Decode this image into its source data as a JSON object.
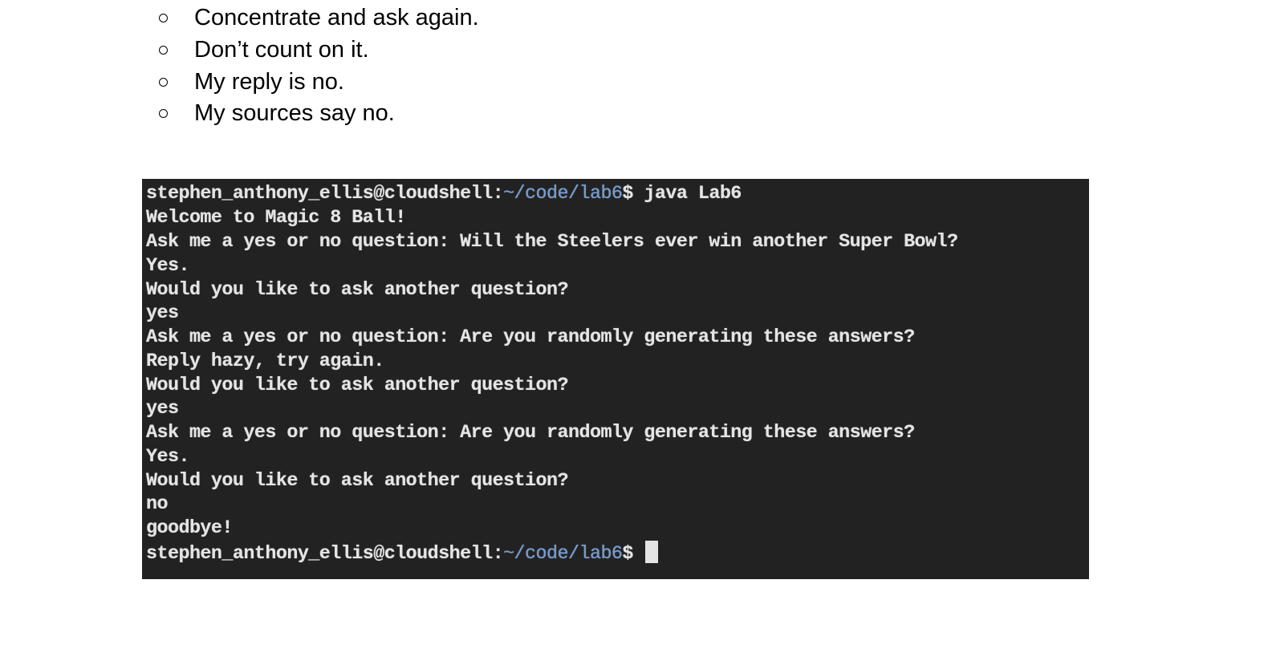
{
  "bullet_list": {
    "items": [
      {
        "label": "Concentrate and ask again."
      },
      {
        "label": "Don’t count on it."
      },
      {
        "label": "My reply is no."
      },
      {
        "label": "My sources say no."
      }
    ]
  },
  "terminal": {
    "background": "#222222",
    "path_color": "#6f9bd6",
    "prompt_user": "stephen_anthony_ellis@cloudshell:",
    "prompt_path": "~/code/lab6",
    "prompt_symbol": "$",
    "command": " java Lab6",
    "output_lines": [
      "Welcome to Magic 8 Ball!",
      "Ask me a yes or no question: Will the Steelers ever win another Super Bowl?",
      "Yes.",
      "Would you like to ask another question?",
      "yes",
      "Ask me a yes or no question: Are you randomly generating these answers?",
      "Reply hazy, try again.",
      "Would you like to ask another question?",
      "yes",
      "Ask me a yes or no question: Are you randomly generating these answers?",
      "Yes.",
      "Would you like to ask another question?",
      "no",
      "goodbye!"
    ]
  }
}
